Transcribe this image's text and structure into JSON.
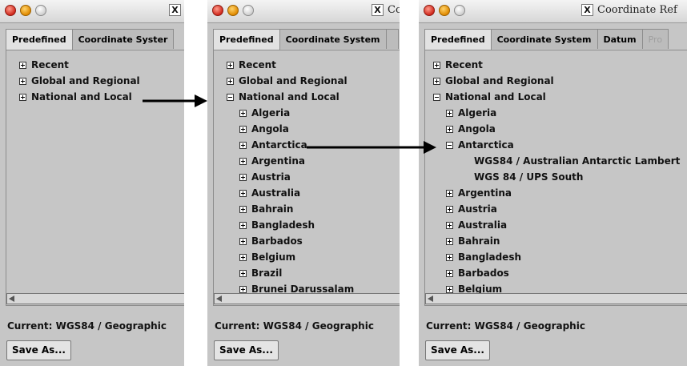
{
  "window_titles": [
    "",
    "Co",
    "Coordinate Ref"
  ],
  "tabs": {
    "panel1": [
      "Predefined",
      "Coordinate Syster"
    ],
    "panel2": [
      "Predefined",
      "Coordinate System",
      ""
    ],
    "panel3": [
      "Predefined",
      "Coordinate System",
      "Datum",
      "Pro"
    ]
  },
  "trees": {
    "panel1": [
      {
        "label": "Recent",
        "state": "plus"
      },
      {
        "label": "Global and Regional",
        "state": "plus"
      },
      {
        "label": "National and Local",
        "state": "plus"
      }
    ],
    "panel2": [
      {
        "label": "Recent",
        "state": "plus"
      },
      {
        "label": "Global and Regional",
        "state": "plus"
      },
      {
        "label": "National and Local",
        "state": "minus"
      },
      {
        "label": "Algeria",
        "state": "plus"
      },
      {
        "label": "Angola",
        "state": "plus"
      },
      {
        "label": "Antarctica",
        "state": "plus"
      },
      {
        "label": "Argentina",
        "state": "plus"
      },
      {
        "label": "Austria",
        "state": "plus"
      },
      {
        "label": "Australia",
        "state": "plus"
      },
      {
        "label": "Bahrain",
        "state": "plus"
      },
      {
        "label": "Bangladesh",
        "state": "plus"
      },
      {
        "label": "Barbados",
        "state": "plus"
      },
      {
        "label": "Belgium",
        "state": "plus"
      },
      {
        "label": "Brazil",
        "state": "plus"
      },
      {
        "label": "Brunei Darussalam",
        "state": "plus"
      }
    ],
    "panel3": [
      {
        "label": "Recent",
        "state": "plus"
      },
      {
        "label": "Global and Regional",
        "state": "plus"
      },
      {
        "label": "National and Local",
        "state": "minus"
      },
      {
        "label": "Algeria",
        "state": "plus"
      },
      {
        "label": "Angola",
        "state": "plus"
      },
      {
        "label": "Antarctica",
        "state": "minus"
      },
      {
        "label": "WGS84 / Australian Antarctic Lambert",
        "state": "leaf"
      },
      {
        "label": "WGS 84 / UPS South",
        "state": "leaf"
      },
      {
        "label": "Argentina",
        "state": "plus"
      },
      {
        "label": "Austria",
        "state": "plus"
      },
      {
        "label": "Australia",
        "state": "plus"
      },
      {
        "label": "Bahrain",
        "state": "plus"
      },
      {
        "label": "Bangladesh",
        "state": "plus"
      },
      {
        "label": "Barbados",
        "state": "plus"
      },
      {
        "label": "Belgium",
        "state": "plus"
      }
    ]
  },
  "current_label": "Current: WGS84 / Geographic",
  "save_as_label": "Save As...",
  "x_logo": "X"
}
